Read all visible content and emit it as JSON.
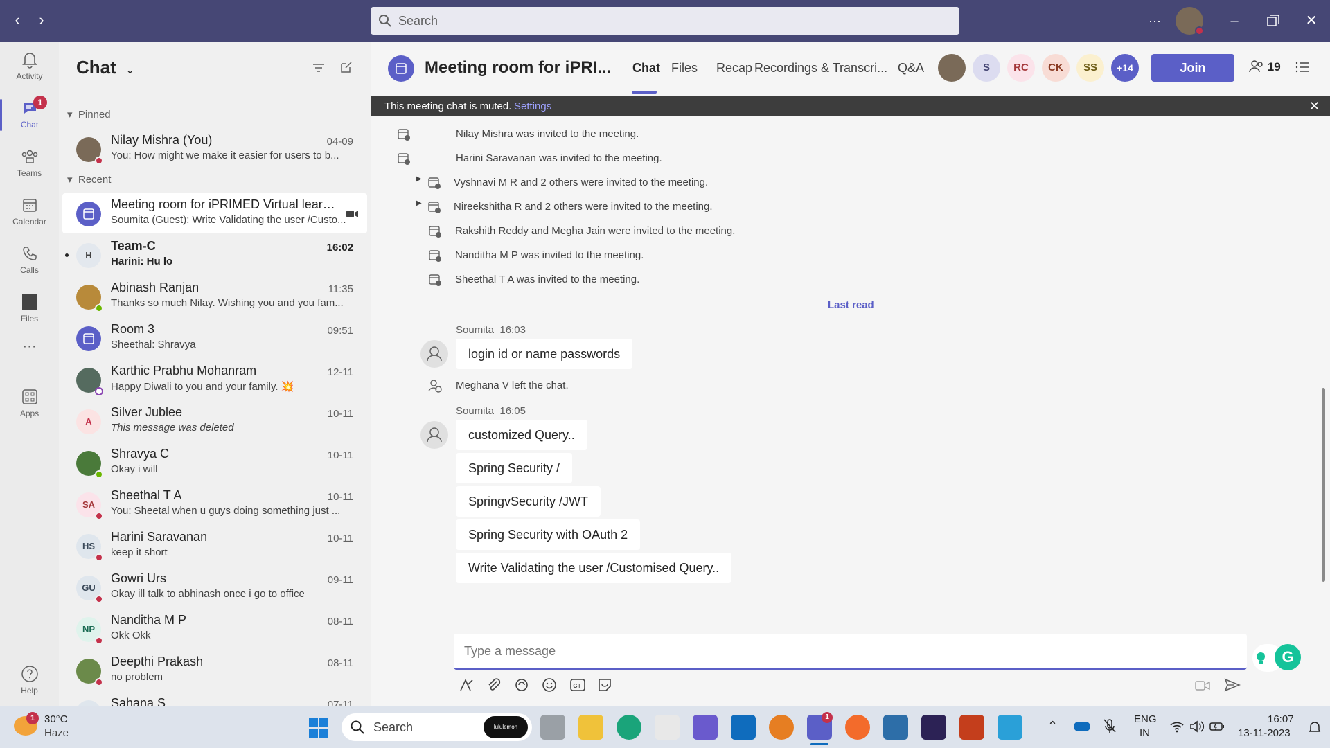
{
  "titlebar": {
    "search_placeholder": "Search",
    "more": "···"
  },
  "rail": {
    "items": [
      {
        "label": "Activity",
        "icon": "bell-icon"
      },
      {
        "label": "Chat",
        "icon": "chat-icon",
        "badge": "1"
      },
      {
        "label": "Teams",
        "icon": "teams-icon"
      },
      {
        "label": "Calendar",
        "icon": "calendar-icon"
      },
      {
        "label": "Calls",
        "icon": "phone-icon"
      },
      {
        "label": "Files",
        "icon": "files-icon"
      },
      {
        "label": "···",
        "icon": "more-icon"
      },
      {
        "label": "Apps",
        "icon": "apps-icon"
      },
      {
        "label": "Help",
        "icon": "help-icon"
      }
    ]
  },
  "chatlist": {
    "title": "Chat",
    "pinned_label": "Pinned",
    "recent_label": "Recent",
    "pinned": [
      {
        "name": "Nilay Mishra (You)",
        "preview": "You: How might we make it easier for users to b...",
        "time": "04-09"
      }
    ],
    "recent": [
      {
        "name": "Meeting room for iPRIMED Virtual learnin...",
        "preview": "Soumita (Guest): Write Validating the user /Custo...",
        "time": ""
      },
      {
        "name": "Team-C",
        "preview": "Harini: Hu lo",
        "time": "16:02",
        "initials": "H"
      },
      {
        "name": "Abinash Ranjan",
        "preview": "Thanks so much Nilay. Wishing you and you fam...",
        "time": "11:35"
      },
      {
        "name": "Room 3",
        "preview": "Sheethal: Shravya",
        "time": "09:51"
      },
      {
        "name": "Karthic Prabhu Mohanram",
        "preview": "Happy Diwali to you and your family. 💥",
        "time": "12-11"
      },
      {
        "name": "Silver Jublee",
        "preview": "This message was deleted",
        "time": "10-11",
        "initials": "A"
      },
      {
        "name": "Shravya C",
        "preview": "Okay i will",
        "time": "10-11"
      },
      {
        "name": "Sheethal T A",
        "preview": "You: Sheetal when u guys doing something just ...",
        "time": "10-11",
        "initials": "SA"
      },
      {
        "name": "Harini Saravanan",
        "preview": "keep it short",
        "time": "10-11",
        "initials": "HS"
      },
      {
        "name": "Gowri Urs",
        "preview": "Okay ill talk to abhinash once i go to office",
        "time": "09-11",
        "initials": "GU"
      },
      {
        "name": "Nanditha M P",
        "preview": "Okk Okk",
        "time": "08-11",
        "initials": "NP"
      },
      {
        "name": "Deepthi Prakash",
        "preview": "no problem",
        "time": "08-11"
      },
      {
        "name": "Sahana S",
        "preview": "",
        "time": "07-11"
      }
    ]
  },
  "main": {
    "title": "Meeting room for iPRI...",
    "tabs": [
      "Chat",
      "Files",
      "Recap",
      "Recordings & Transcri...",
      "Q&A"
    ],
    "participants": [
      "S",
      "RC",
      "CK",
      "SS",
      "+14"
    ],
    "join_label": "Join",
    "people_count": "19",
    "banner_text": "This meeting chat is muted.",
    "banner_link": "Settings",
    "system_lines": [
      "Nilay Mishra was invited to the meeting.",
      "Harini Saravanan was invited to the meeting.",
      "Vyshnavi M R and 2 others were invited to the meeting.",
      "Nireekshitha R and 2 others were invited to the meeting.",
      "Rakshith Reddy and Megha Jain were invited to the meeting.",
      "Nanditha M P was invited to the meeting.",
      "Sheethal T A was invited to the meeting."
    ],
    "last_read": "Last read",
    "messages": [
      {
        "sender": "Soumita",
        "time": "16:03",
        "bubbles": [
          "login id or name  passwords"
        ]
      },
      {
        "system": "Meghana V left the chat."
      },
      {
        "sender": "Soumita",
        "time": "16:05",
        "bubbles": [
          "customized Query..",
          "Spring Security /",
          "SpringvSecurity /JWT",
          "Spring Security with OAuth 2",
          "Write Validating the user /Customised Query.."
        ]
      }
    ],
    "composer_placeholder": "Type a message"
  },
  "taskbar": {
    "weather_temp": "30°C",
    "weather_desc": "Haze",
    "weather_badge": "1",
    "search_placeholder": "Search",
    "search_logo": "lululemon",
    "lang": "ENG",
    "lang_region": "IN",
    "time": "16:07",
    "date": "13-11-2023"
  },
  "colors": {
    "accent": "#5b5fc7",
    "titlebar": "#464775",
    "badge": "#c4314b"
  }
}
